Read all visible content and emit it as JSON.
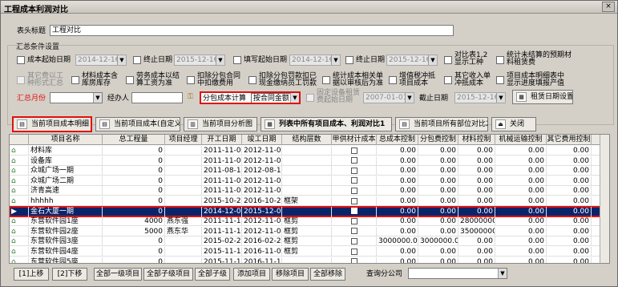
{
  "window": {
    "title": "工程成本利润对比",
    "close_glyph": "×"
  },
  "header": {
    "title_label": "表头标题",
    "title_value": "工程对比"
  },
  "conditions": {
    "group_label": "汇总条件设置",
    "row1": [
      {
        "label": "成本起始日期",
        "date": "2014-12-16"
      },
      {
        "label": "终止日期",
        "date": "2015-12-16"
      },
      {
        "label": "填写起始日期",
        "date": "2014-12-16"
      },
      {
        "label": "终止日期",
        "date": "2015-12-16"
      },
      {
        "label": "对比表1,2显示工种"
      },
      {
        "label": "统计未结算的预期材料租赁费"
      }
    ],
    "row2": [
      {
        "label": "其它费以工种形式汇总"
      },
      {
        "label": "材料成本含库房库存"
      },
      {
        "label": "劳务成本以结算工资为准"
      },
      {
        "label": "扣除分包合同中扣缴费用"
      },
      {
        "label": "扣除分包罚款扣已现金缴纳员工罚款"
      },
      {
        "label": "统计成本相关单据以审核后为准"
      },
      {
        "label": "增值税冲抵项目成本"
      },
      {
        "label": "其它收入单冲抵成本"
      },
      {
        "label": "项目成本明细表中显示进度填报产值"
      }
    ],
    "row3": {
      "month_label": "汇总月份",
      "handler_label": "经办人",
      "subcontract_cost": "分包成本计算",
      "contract_amount": "按合同金额",
      "fixed_asset_label": "固定设备租赁费起始日期",
      "fixed_asset_date": "2007-01-01",
      "cutoff_label": "截止日期",
      "cutoff_date": "2015-12-16",
      "rent_button": "租赁日期设置"
    }
  },
  "toolbar": [
    {
      "label": "当前项目成本明细"
    },
    {
      "label": "当前项目成本(自定义)"
    },
    {
      "label": "当前项目分析图"
    },
    {
      "label": "列表中所有项目成本、利润对比1"
    },
    {
      "label": "当前项目所有部位对比2"
    },
    {
      "label": "关闭"
    }
  ],
  "grid": {
    "columns": [
      "项目名称",
      "总工程量",
      "项目经理",
      "开工日期",
      "竣工日期",
      "结构层数",
      "甲供材计成本",
      "总成本控制",
      "分包费控制",
      "材料控制",
      "机械运输控制",
      "其它费用控制"
    ],
    "rows": [
      [
        "材料库",
        "0",
        "",
        "2011-11-02",
        "2012-11-01",
        "",
        "",
        "0.00",
        "0.00",
        "0.00",
        "0.00",
        "0.00"
      ],
      [
        "设备库",
        "0",
        "",
        "2011-11-02",
        "2012-11-01",
        "",
        "",
        "0.00",
        "0.00",
        "0.00",
        "0.00",
        "0.00"
      ],
      [
        "众城广场一期",
        "0",
        "",
        "2011-08-17",
        "2012-08-16",
        "",
        "",
        "0.00",
        "0.00",
        "0.00",
        "0.00",
        "0.00"
      ],
      [
        "众城广场二期",
        "0",
        "",
        "2011-11-08",
        "2012-11-07",
        "",
        "",
        "0.00",
        "0.00",
        "0.00",
        "0.00",
        "0.00"
      ],
      [
        "济青高速",
        "0",
        "",
        "2011-11-07",
        "2012-11-06",
        "",
        "",
        "0.00",
        "0.00",
        "0.00",
        "0.00",
        "0.00"
      ],
      [
        "hhhhh",
        "0",
        "",
        "2015-10-26",
        "2016-10-25",
        "框架",
        "",
        "0.00",
        "0.00",
        "0.00",
        "0.00",
        "0.00"
      ],
      [
        "金石大厦一期",
        "0",
        "",
        "2014-12-06",
        "2015-12-06",
        "",
        "",
        "0.00",
        "0.00",
        "0.00",
        "0.00",
        "0.00"
      ],
      [
        "东营软件园1座",
        "4000",
        "燕东强",
        "2011-11-10",
        "2012-11-09",
        "框剪",
        "",
        "0.00",
        "0.00",
        "28000000.",
        "0.00",
        "0.00"
      ],
      [
        "东营软件园2座",
        "5000",
        "燕东华",
        "2011-11-10",
        "2012-11-09",
        "框剪",
        "",
        "0.00",
        "0.00",
        "35000000.",
        "0.00",
        "0.00"
      ],
      [
        "东营软件园3座",
        "0",
        "",
        "2015-02-27",
        "2016-02-27",
        "框剪",
        "",
        "3000000.00",
        "3000000.00",
        "0.00",
        "0.00",
        "0.00"
      ],
      [
        "东营软件园4座",
        "0",
        "",
        "2015-11-10",
        "2016-11-09",
        "框剪",
        "",
        "0.00",
        "0.00",
        "0.00",
        "0.00",
        "0.00"
      ],
      [
        "东营软件园5座",
        "0",
        "",
        "2015-11-17",
        "2016-11-17",
        "",
        "",
        "0.00",
        "0.00",
        "0.00",
        "0.00",
        "0.00"
      ]
    ],
    "selected_index": 6
  },
  "bottom": {
    "buttons": [
      "[1]上移",
      "[2]下移",
      "全部一级项目",
      "全部子级项目",
      "全部子级",
      "添加项目",
      "移除项目",
      "全部移除"
    ],
    "branch_label": "查询分公司"
  }
}
